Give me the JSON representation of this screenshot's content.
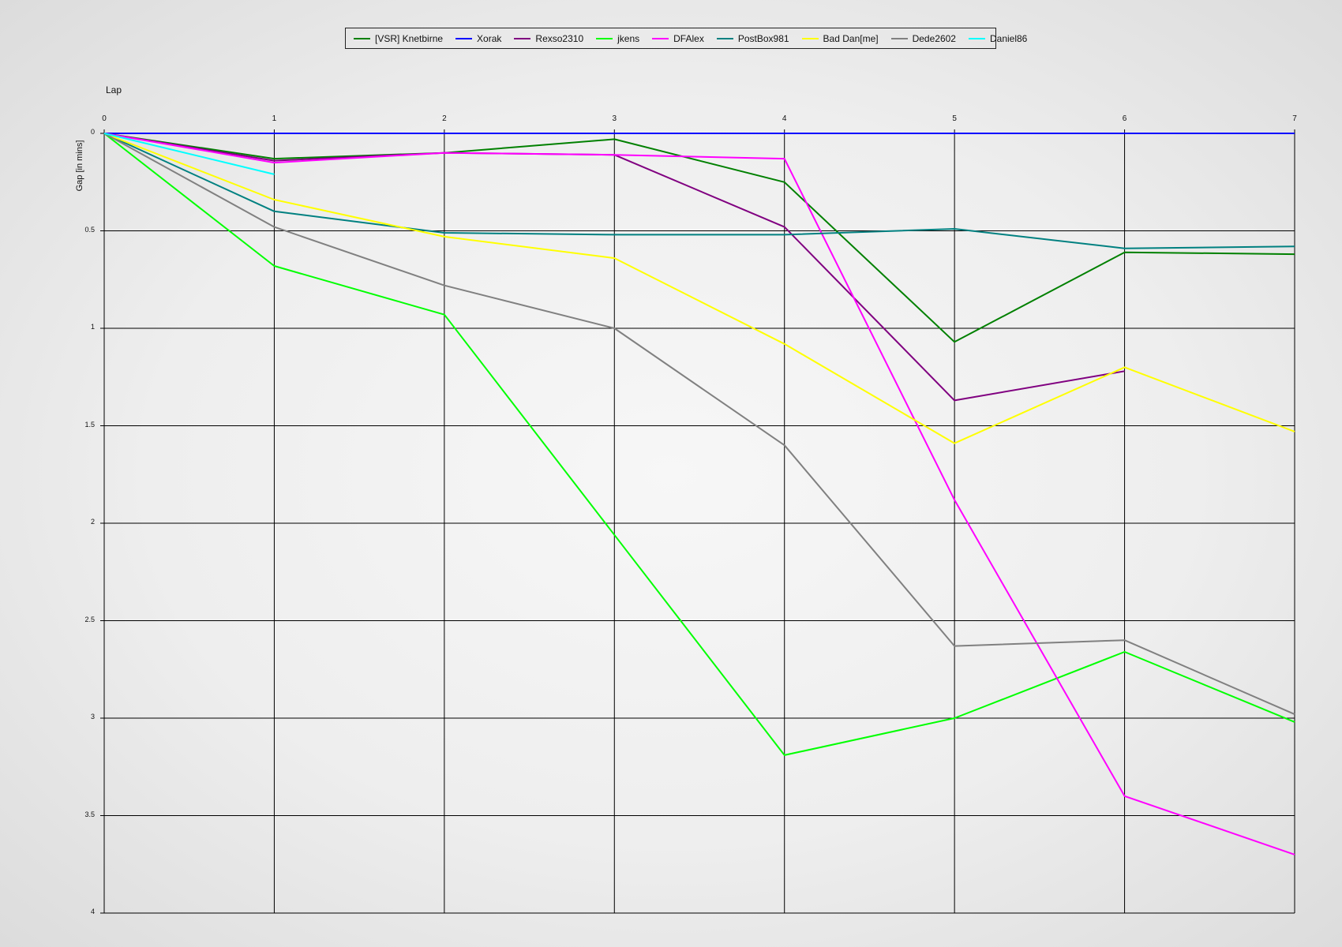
{
  "chart_data": {
    "type": "line",
    "title": "",
    "xlabel": "Lap",
    "ylabel": "Gap [in mins]",
    "x": [
      0,
      1,
      2,
      3,
      4,
      5,
      6,
      7
    ],
    "xlim": [
      0,
      7
    ],
    "ylim": [
      0,
      4
    ],
    "y_inverted": true,
    "xticks": [
      "0",
      "1",
      "2",
      "3",
      "4",
      "5",
      "6",
      "7"
    ],
    "yticks": [
      "0",
      "0.5",
      "1",
      "1.5",
      "2",
      "2.5",
      "3",
      "3.5",
      "4"
    ],
    "grid": true,
    "legend_position": "top",
    "series": [
      {
        "name": "[VSR] Knetbirne",
        "color": "#008000",
        "values": [
          0,
          0.13,
          0.1,
          0.03,
          0.25,
          1.07,
          0.61,
          0.62
        ]
      },
      {
        "name": "Xorak",
        "color": "#0000ff",
        "values": [
          0,
          0,
          0,
          0,
          0,
          0,
          0,
          0
        ]
      },
      {
        "name": "Rexso2310",
        "color": "#800080",
        "values": [
          0,
          0.14,
          0.1,
          0.11,
          0.48,
          1.37,
          1.22,
          null
        ]
      },
      {
        "name": "jkens",
        "color": "#00ff00",
        "values": [
          0,
          0.68,
          0.93,
          2.06,
          3.19,
          3.0,
          2.66,
          3.02
        ]
      },
      {
        "name": "DFAlex",
        "color": "#ff00ff",
        "values": [
          0,
          0.15,
          0.1,
          0.11,
          0.13,
          1.88,
          3.4,
          3.7
        ]
      },
      {
        "name": "PostBox981",
        "color": "#008080",
        "values": [
          0,
          0.4,
          0.51,
          0.52,
          0.52,
          0.49,
          0.59,
          0.58
        ]
      },
      {
        "name": "Bad Dan[me]",
        "color": "#ffff00",
        "values": [
          0,
          0.34,
          0.53,
          0.64,
          1.08,
          1.59,
          1.2,
          1.53
        ]
      },
      {
        "name": "Dede2602",
        "color": "#808080",
        "values": [
          0,
          0.48,
          0.78,
          1.0,
          1.6,
          2.63,
          2.6,
          2.98
        ]
      },
      {
        "name": "Daniel86",
        "color": "#00ffff",
        "values": [
          0,
          0.21,
          null,
          null,
          null,
          null,
          null,
          null
        ]
      }
    ]
  }
}
